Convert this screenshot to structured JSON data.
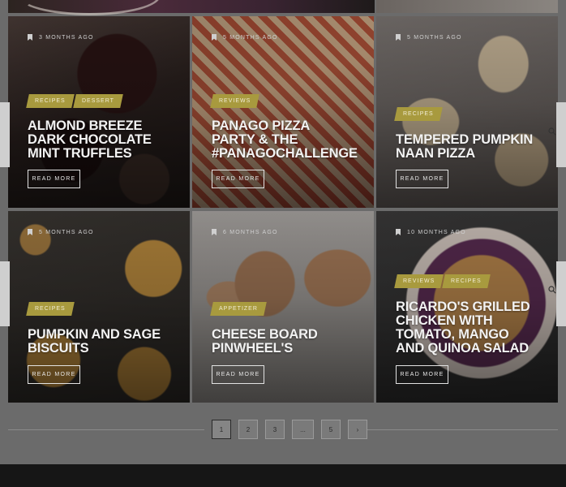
{
  "posts": [
    {
      "meta": "3 MONTHS AGO",
      "tags": [
        "RECIPES",
        "DESSERT"
      ],
      "title": [
        "ALMOND BREEZE",
        "DARK CHOCOLATE",
        "MINT TRUFFLES"
      ],
      "read_more": "READ MORE"
    },
    {
      "meta": "5 MONTHS AGO",
      "tags": [
        "REVIEWS"
      ],
      "title": [
        "PANAGO PIZZA",
        "PARTY & THE",
        "#PANAGOCHALLENGE"
      ],
      "read_more": "READ MORE"
    },
    {
      "meta": "5 MONTHS AGO",
      "tags": [
        "RECIPES"
      ],
      "title": [
        "TEMPERED PUMPKIN",
        "NAAN PIZZA"
      ],
      "read_more": "READ MORE"
    },
    {
      "meta": "5 MONTHS AGO",
      "tags": [
        "RECIPES"
      ],
      "title": [
        "PUMPKIN AND SAGE",
        "BISCUITS"
      ],
      "read_more": "READ MORE"
    },
    {
      "meta": "6 MONTHS AGO",
      "tags": [
        "APPETIZER"
      ],
      "title": [
        "CHEESE BOARD",
        "PINWHEEL'S"
      ],
      "read_more": "READ MORE"
    },
    {
      "meta": "10 MONTHS AGO",
      "tags": [
        "REVIEWS",
        "RECIPES"
      ],
      "title": [
        "RICARDO'S GRILLED",
        "CHICKEN WITH",
        "TOMATO, MANGO",
        "AND QUINOA SALAD"
      ],
      "read_more": "READ MORE"
    }
  ],
  "pagination": [
    "1",
    "2",
    "3",
    "...",
    "5",
    "›"
  ],
  "pagination_current": "1",
  "colors": {
    "tag": "#a89a3e",
    "footer": "#161616"
  }
}
